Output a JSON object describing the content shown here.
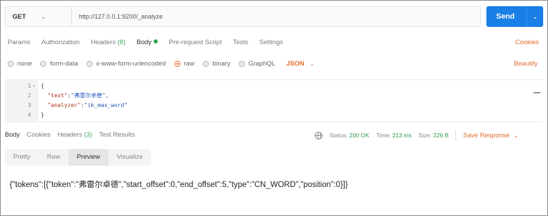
{
  "request": {
    "method": "GET",
    "url": "http://127.0.0.1:9200/_analyze",
    "send_label": "Send"
  },
  "tabs": {
    "params": "Params",
    "authorization": "Authorization",
    "headers": "Headers",
    "headers_count": "(8)",
    "body": "Body",
    "prerequest": "Pre-request Script",
    "tests": "Tests",
    "settings": "Settings",
    "cookies": "Cookies"
  },
  "body_types": {
    "none": "none",
    "form_data": "form-data",
    "urlencoded": "x-www-form-urlencoded",
    "raw": "raw",
    "binary": "binary",
    "graphql": "GraphQL",
    "format": "JSON",
    "beautify": "Beautify"
  },
  "editor": {
    "lines": [
      {
        "num": "1",
        "text": "{"
      },
      {
        "num": "2",
        "key": "\"text\"",
        "value": "\"弗雷尔卓德\","
      },
      {
        "num": "3",
        "key": "\"analyzer\"",
        "value": "\"ik_max_word\""
      },
      {
        "num": "4",
        "text": "}"
      }
    ]
  },
  "response": {
    "tabs": {
      "body": "Body",
      "cookies": "Cookies",
      "headers": "Headers",
      "headers_count": "(3)",
      "test_results": "Test Results"
    },
    "status_label": "Status:",
    "status_value": "200 OK",
    "time_label": "Time:",
    "time_value": "213 ms",
    "size_label": "Size:",
    "size_value": "226 B",
    "save_label": "Save Response",
    "modes": {
      "pretty": "Pretty",
      "raw": "Raw",
      "preview": "Preview",
      "visualize": "Visualize"
    },
    "body_text": "{\"tokens\":[{\"token\":\"弗雷尔卓德\",\"start_offset\":0,\"end_offset\":5,\"type\":\"CN_WORD\",\"position\":0}]}"
  },
  "colors": {
    "accent_orange": "#e06b2e",
    "send_blue": "#1a7fe6",
    "status_green": "#2c9a47"
  }
}
